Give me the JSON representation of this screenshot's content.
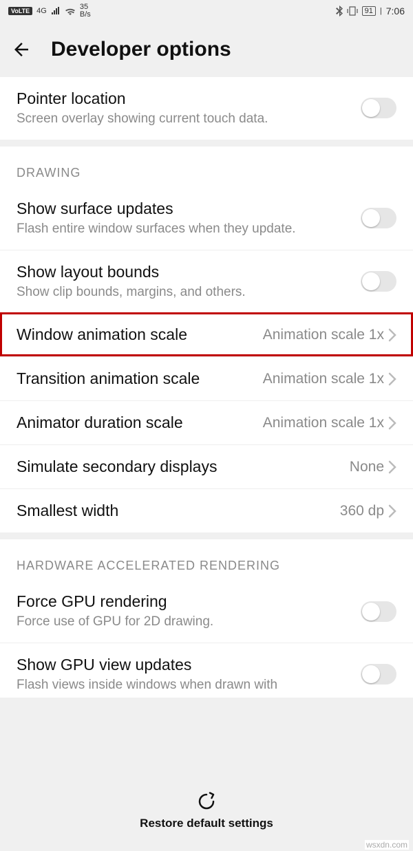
{
  "status": {
    "volte": "VoLTE",
    "net": "4G",
    "speed_top": "35",
    "speed_bot": "B/s",
    "battery": "91",
    "time": "7:06"
  },
  "header": {
    "title": "Developer options"
  },
  "top_partial": {
    "title": "Pointer location",
    "desc": "Screen overlay showing current touch data."
  },
  "drawing": {
    "header": "DRAWING",
    "items": {
      "surface": {
        "title": "Show surface updates",
        "desc": "Flash entire window surfaces when they update."
      },
      "layout": {
        "title": "Show layout bounds",
        "desc": "Show clip bounds, margins, and others."
      },
      "window_anim": {
        "title": "Window animation scale",
        "value": "Animation scale 1x"
      },
      "transition_anim": {
        "title": "Transition animation scale",
        "value": "Animation scale 1x"
      },
      "animator_dur": {
        "title": "Animator duration scale",
        "value": "Animation scale 1x"
      },
      "secondary": {
        "title": "Simulate secondary displays",
        "value": "None"
      },
      "smallest": {
        "title": "Smallest width",
        "value": "360 dp"
      }
    }
  },
  "hardware": {
    "header": "HARDWARE ACCELERATED RENDERING",
    "items": {
      "force_gpu": {
        "title": "Force GPU rendering",
        "desc": "Force use of GPU for 2D drawing."
      },
      "show_gpu": {
        "title": "Show GPU view updates",
        "desc": "Flash views inside windows when drawn with"
      }
    }
  },
  "bottom": {
    "label": "Restore default settings"
  },
  "watermark": "wsxdn.com"
}
